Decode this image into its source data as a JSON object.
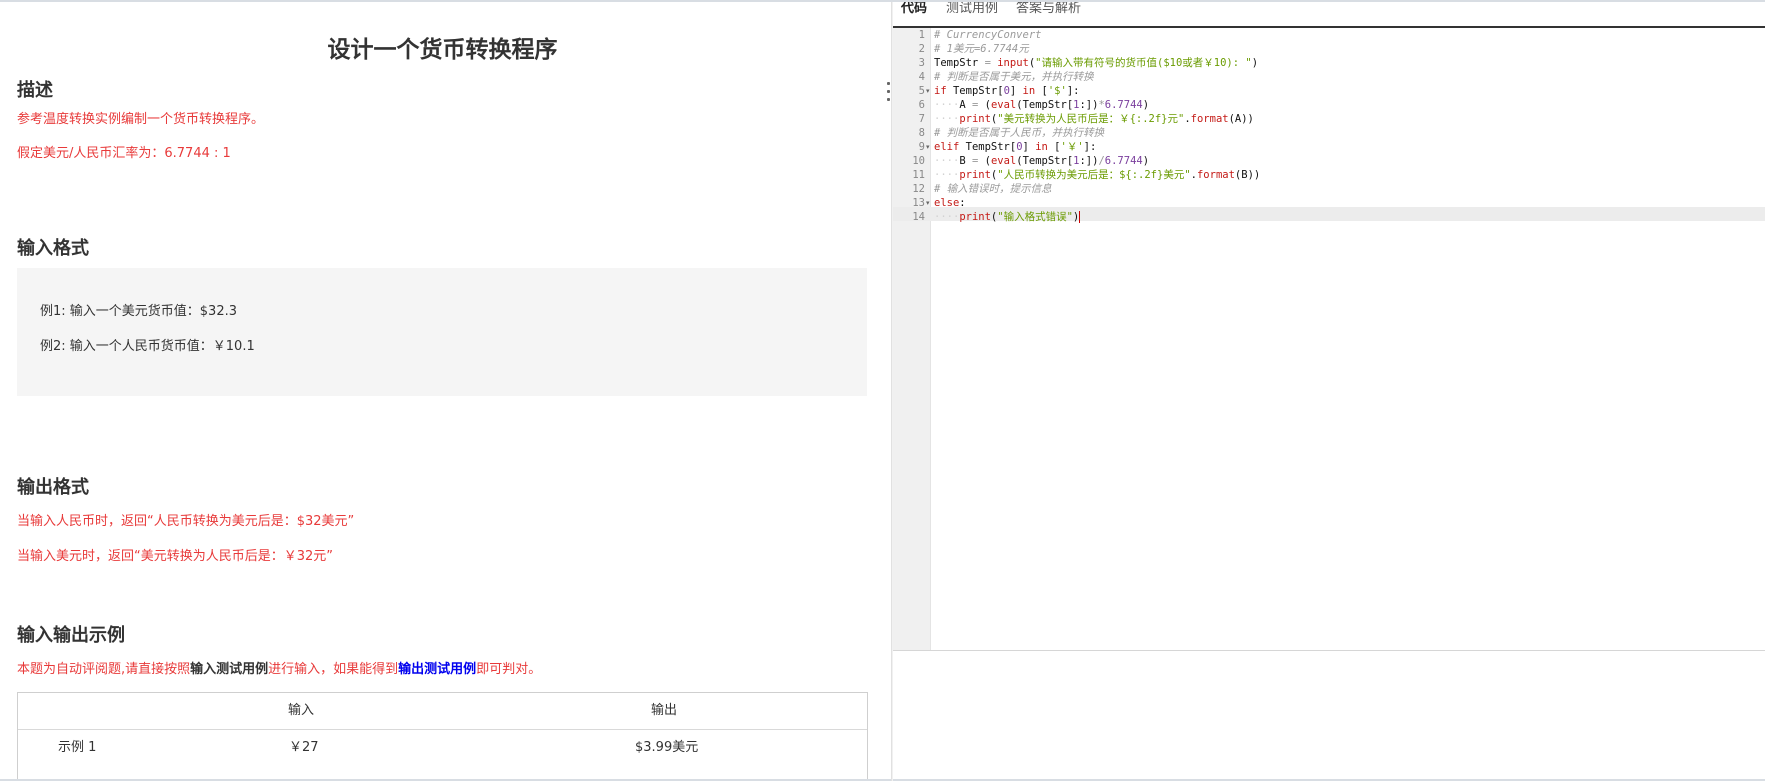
{
  "problem": {
    "title": "设计一个货币转换程序",
    "description_heading": "描述",
    "description_lines": [
      "参考温度转换实例编制一个货币转换程序。",
      "假定美元/人民币汇率为：6.7744 : 1"
    ],
    "input_heading": "输入格式",
    "input_examples": [
      "例1: 输入一个美元货币值：$32.3",
      "例2: 输入一个人民币货币值：￥10.1"
    ],
    "output_heading": "输出格式",
    "output_lines": [
      "当输入人民币时，返回“人民币转换为美元后是：$32美元”",
      "当输入美元时，返回“美元转换为人民币后是：￥32元”"
    ],
    "io_heading": "输入输出示例",
    "io_note": {
      "prefix": "本题为自动评阅题,请直接按照",
      "bold1": "输入测试用例",
      "mid": "进行输入，如果能得到",
      "bold2": "输出测试用例",
      "suffix": "即可判对。"
    },
    "table": {
      "headers": [
        "",
        "输入",
        "输出"
      ],
      "rows": [
        {
          "label": "示例 1",
          "input": "￥27",
          "output": "$3.99美元"
        }
      ]
    }
  },
  "editor": {
    "tabs": [
      {
        "label": "代码",
        "active": true
      },
      {
        "label": "测试用例",
        "active": false
      },
      {
        "label": "答案与解析",
        "active": false
      }
    ],
    "line_numbers": [
      "1",
      "2",
      "3",
      "4",
      "5",
      "6",
      "7",
      "8",
      "9",
      "10",
      "11",
      "12",
      "13",
      "14"
    ],
    "lines": [
      "# CurrencyConvert",
      "# 1美元=6.7744元",
      "TempStr = input(\"请输入带有符号的货币值($10或者￥10): \")",
      "# 判断是否属于美元，并执行转换",
      "if TempStr[0] in ['$']:",
      "    A = (eval(TempStr[1:])*6.7744)",
      "    print(\"美元转换为人民币后是：￥{:.2f}元\".format(A))",
      "# 判断是否属于人民币，并执行转换",
      "elif TempStr[0] in ['￥']:",
      "    B = (eval(TempStr[1:])/6.7744)",
      "    print(\"人民币转换为美元后是：${:.2f}美元\".format(B))",
      "# 输入错误时，提示信息",
      "else:",
      "    print(\"输入格式错误\")"
    ]
  },
  "colors": {
    "accent_red": "#e83a3a",
    "link_blue": "#0000ee",
    "string_green": "#6a9b00",
    "keyword_red": "#c41a16",
    "number_purple": "#7a3e9d",
    "comment_gray": "#9a9a9a"
  }
}
